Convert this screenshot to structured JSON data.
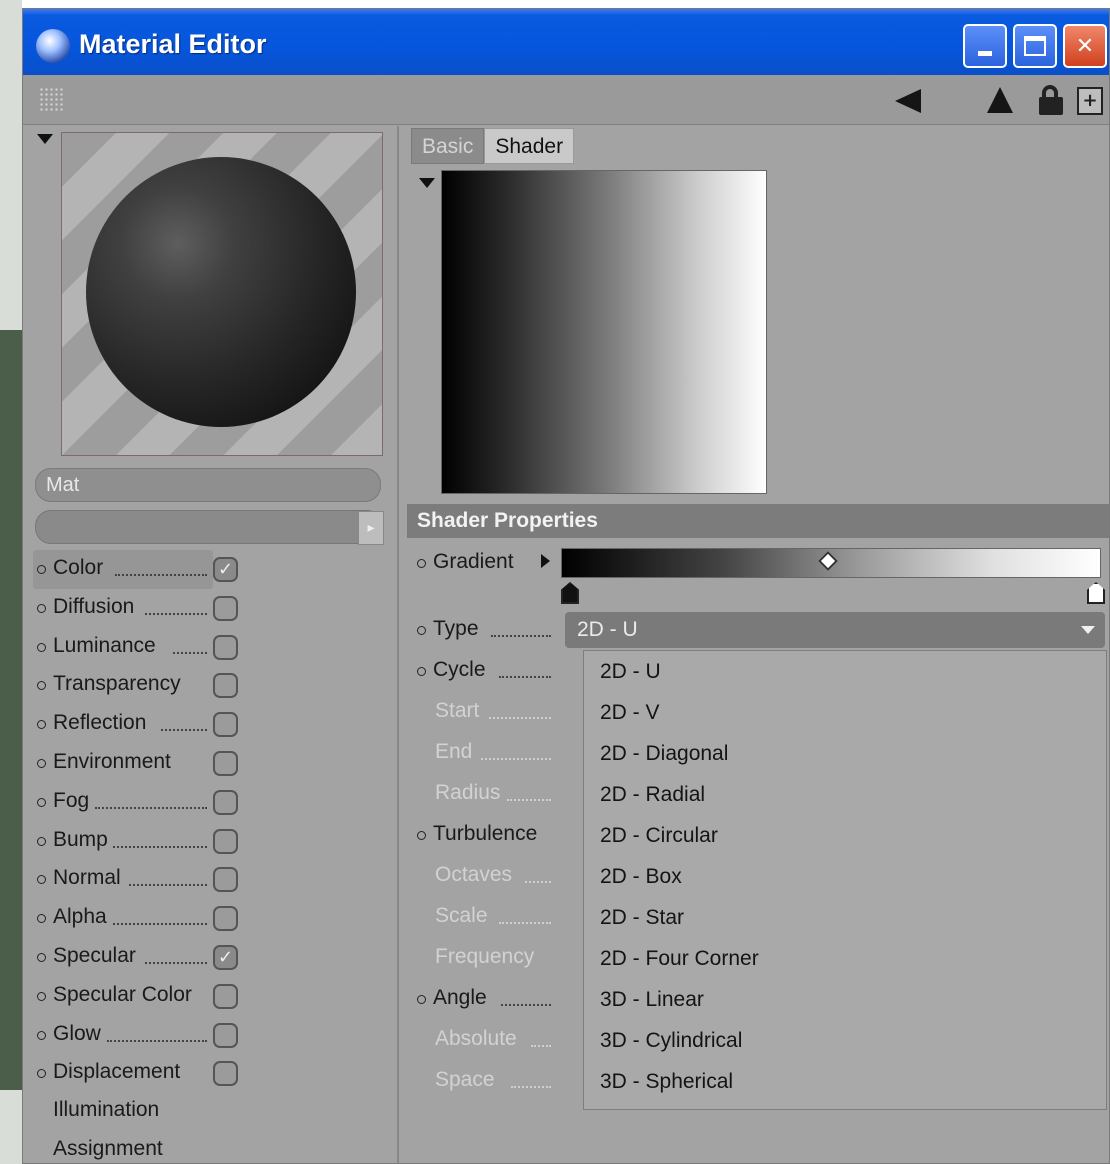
{
  "window": {
    "title": "Material Editor"
  },
  "toolbar": {
    "icons": [
      "grip-icon",
      "arrow-left-icon",
      "arrow-up-icon",
      "lock-icon",
      "new-window-icon"
    ]
  },
  "preview": {
    "material_name": "Mat"
  },
  "channels": [
    {
      "label": "Color",
      "checked": true
    },
    {
      "label": "Diffusion",
      "checked": false
    },
    {
      "label": "Luminance",
      "checked": false
    },
    {
      "label": "Transparency",
      "checked": false
    },
    {
      "label": "Reflection",
      "checked": false
    },
    {
      "label": "Environment",
      "checked": false
    },
    {
      "label": "Fog",
      "checked": false
    },
    {
      "label": "Bump",
      "checked": false
    },
    {
      "label": "Normal",
      "checked": false
    },
    {
      "label": "Alpha",
      "checked": false
    },
    {
      "label": "Specular",
      "checked": true
    },
    {
      "label": "Specular Color",
      "checked": false
    },
    {
      "label": "Glow",
      "checked": false
    },
    {
      "label": "Displacement",
      "checked": false
    }
  ],
  "extra_labels": {
    "illumination": "Illumination",
    "assignment": "Assignment"
  },
  "tabs": {
    "basic": "Basic",
    "shader": "Shader"
  },
  "shader_properties": {
    "header": "Shader Properties",
    "gradient_label": "Gradient",
    "props": [
      {
        "label": "Type",
        "enabled": true
      },
      {
        "label": "Cycle",
        "enabled": true
      },
      {
        "label": "Start",
        "enabled": false
      },
      {
        "label": "End",
        "enabled": false
      },
      {
        "label": "Radius",
        "enabled": false
      },
      {
        "label": "Turbulence",
        "enabled": true
      },
      {
        "label": "Octaves",
        "enabled": false
      },
      {
        "label": "Scale",
        "enabled": false
      },
      {
        "label": "Frequency",
        "enabled": false
      },
      {
        "label": "Angle",
        "enabled": true
      },
      {
        "label": "Absolute",
        "enabled": false
      },
      {
        "label": "Space",
        "enabled": false
      }
    ],
    "type_selected": "2D - U",
    "type_options": [
      "2D - U",
      "2D - V",
      "2D - Diagonal",
      "2D - Radial",
      "2D - Circular",
      "2D - Box",
      "2D - Star",
      "2D - Four Corner",
      "3D - Linear",
      "3D - Cylindrical",
      "3D - Spherical"
    ]
  },
  "colors": {
    "title_blue": "#0556dc",
    "panel_gray": "#a3a3a3",
    "close_red": "#d0401e"
  }
}
